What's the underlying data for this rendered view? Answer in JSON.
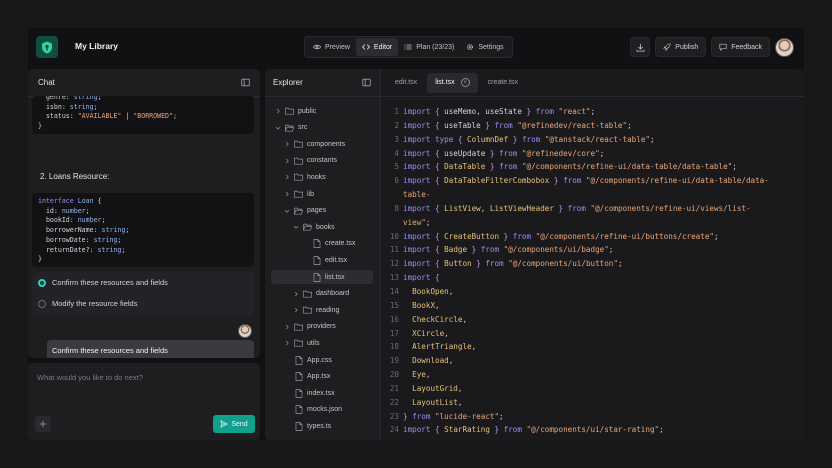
{
  "header": {
    "app_title": "My Library",
    "modes": [
      {
        "label": "Preview",
        "icon": "eye-icon"
      },
      {
        "label": "Editor",
        "icon": "code-icon",
        "active": true
      },
      {
        "label": "Plan (23/23)",
        "icon": "list-icon"
      },
      {
        "label": "Settings",
        "icon": "gear-icon"
      }
    ],
    "publish_label": "Publish",
    "feedback_label": "Feedback"
  },
  "chat": {
    "title": "Chat",
    "heading": "2. Loans Resource:",
    "options": [
      {
        "label": "Confirm these resources and fields",
        "selected": true
      },
      {
        "label": "Modify the resource fields",
        "selected": false
      }
    ],
    "user_message": "Confirm these resources and fields",
    "composer_placeholder": "What would you like to do next?",
    "send_label": "Send"
  },
  "explorer": {
    "title": "Explorer",
    "items": [
      {
        "label": "public",
        "type": "folder",
        "depth": 0,
        "open": false
      },
      {
        "label": "src",
        "type": "folder",
        "depth": 0,
        "open": true
      },
      {
        "label": "components",
        "type": "folder",
        "depth": 1,
        "open": false
      },
      {
        "label": "constants",
        "type": "folder",
        "depth": 1,
        "open": false
      },
      {
        "label": "hooks",
        "type": "folder",
        "depth": 1,
        "open": false
      },
      {
        "label": "lib",
        "type": "folder",
        "depth": 1,
        "open": false
      },
      {
        "label": "pages",
        "type": "folder",
        "depth": 1,
        "open": true
      },
      {
        "label": "books",
        "type": "folder",
        "depth": 2,
        "open": true
      },
      {
        "label": "create.tsx",
        "type": "file",
        "depth": 3
      },
      {
        "label": "edit.tsx",
        "type": "file",
        "depth": 3
      },
      {
        "label": "list.tsx",
        "type": "file",
        "depth": 3,
        "selected": true
      },
      {
        "label": "dashboard",
        "type": "folder",
        "depth": 2,
        "open": false
      },
      {
        "label": "reading",
        "type": "folder",
        "depth": 2,
        "open": false
      },
      {
        "label": "providers",
        "type": "folder",
        "depth": 1,
        "open": false
      },
      {
        "label": "utils",
        "type": "folder",
        "depth": 1,
        "open": false
      },
      {
        "label": "App.css",
        "type": "file",
        "depth": 1
      },
      {
        "label": "App.tsx",
        "type": "file",
        "depth": 1
      },
      {
        "label": "index.tsx",
        "type": "file",
        "depth": 1
      },
      {
        "label": "mocks.json",
        "type": "file",
        "depth": 1
      },
      {
        "label": "types.ts",
        "type": "file",
        "depth": 1
      }
    ]
  },
  "editor": {
    "tabs": [
      {
        "label": "edit.tsx",
        "active": false
      },
      {
        "label": "list.tsx",
        "active": true
      },
      {
        "label": "create.tsx",
        "active": false
      }
    ]
  }
}
